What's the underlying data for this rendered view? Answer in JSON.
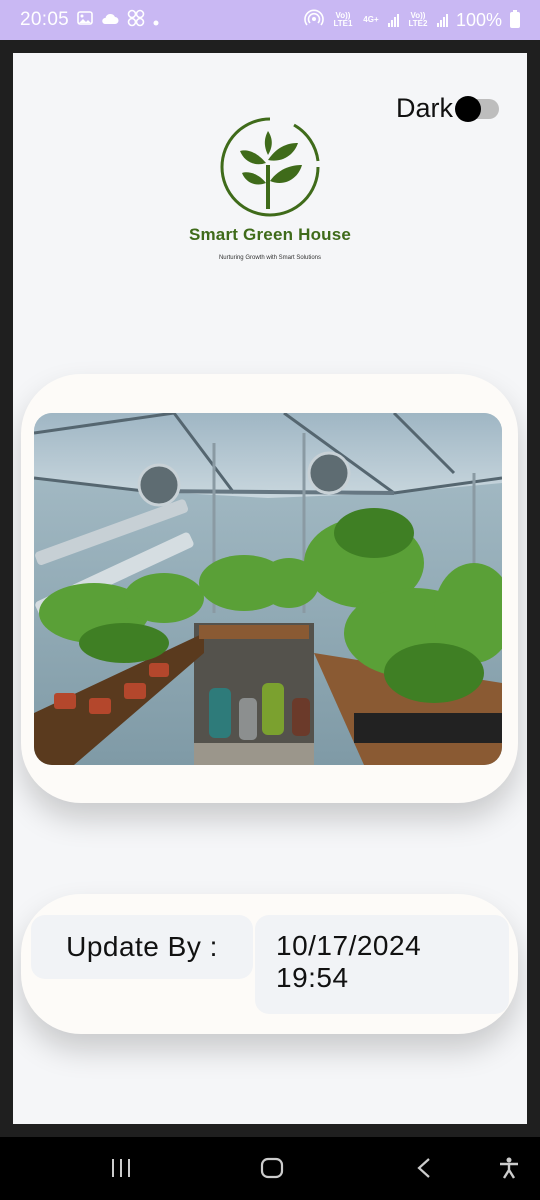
{
  "status_bar": {
    "time": "20:05",
    "battery": "100%",
    "sim1_label": "Vo)) LTE1",
    "sim1_net": "4G+",
    "sim2_label": "Vo)) LTE2",
    "icons": [
      "gallery-icon",
      "cloud-icon",
      "apps-icon",
      "dot-icon",
      "hotspot-icon",
      "signal-icon",
      "battery-icon"
    ]
  },
  "header": {
    "dark_toggle_label": "Dark",
    "dark_mode_on": false
  },
  "logo": {
    "brand": "Smart Green House",
    "tagline": "Nurturing Growth with Smart Solutions"
  },
  "colors": {
    "brand_green": "#3f6b1a",
    "status_bar": "#c9b8f3",
    "card_bg": "#fdfbf8"
  },
  "update": {
    "label": "Update By :",
    "date": "10/17/2024",
    "time": "19:54"
  },
  "nav": {
    "icons": [
      "recents-icon",
      "home-icon",
      "back-icon",
      "accessibility-icon"
    ]
  }
}
